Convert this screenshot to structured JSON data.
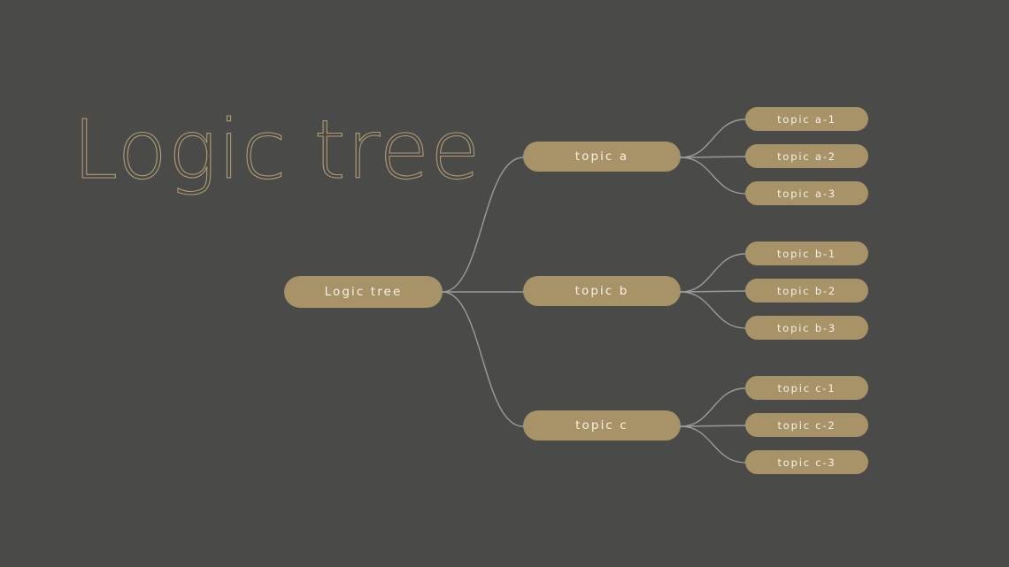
{
  "page": {
    "title": "Logic tree",
    "background_color": "#4a4a48",
    "node_color": "#a89268",
    "node_text_color": "#f6f1e7",
    "title_color": "#b19c73",
    "edge_color": "#9a9a97"
  },
  "tree": {
    "root": {
      "label": "Logic tree"
    },
    "branches": [
      {
        "label": "topic a",
        "children": [
          {
            "label": "topic a-1"
          },
          {
            "label": "topic a-2"
          },
          {
            "label": "topic a-3"
          }
        ]
      },
      {
        "label": "topic b",
        "children": [
          {
            "label": "topic b-1"
          },
          {
            "label": "topic b-2"
          },
          {
            "label": "topic b-3"
          }
        ]
      },
      {
        "label": "topic c",
        "children": [
          {
            "label": "topic c-1"
          },
          {
            "label": "topic c-2"
          },
          {
            "label": "topic c-3"
          }
        ]
      }
    ]
  }
}
